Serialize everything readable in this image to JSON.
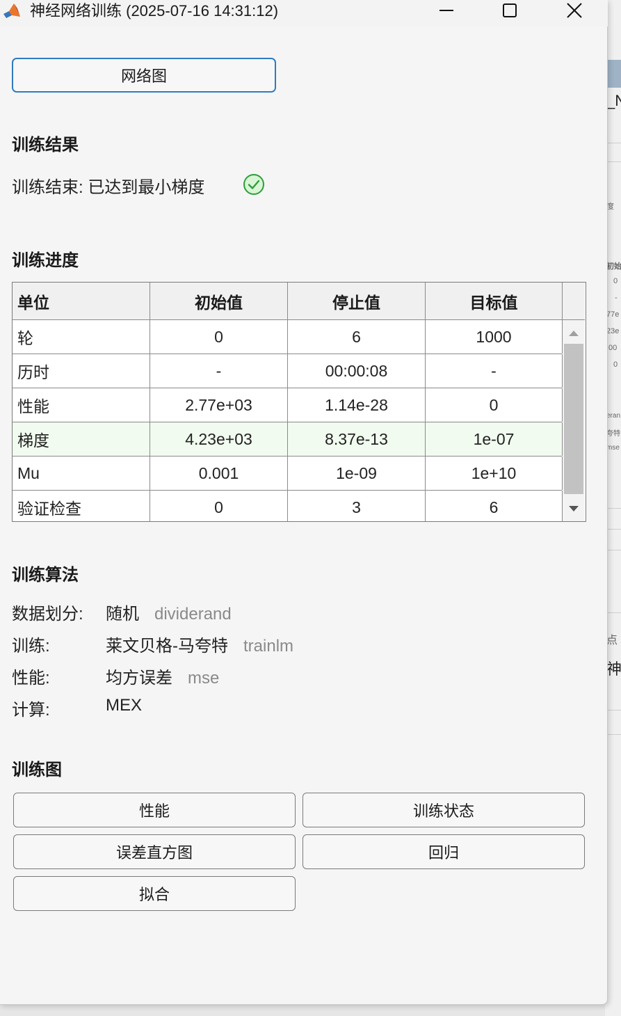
{
  "window": {
    "title": "神经网络训练 (2025-07-16 14:31:12)",
    "controls": [
      "minimize",
      "maximize",
      "close"
    ]
  },
  "network": {
    "button_label": "网络图"
  },
  "results": {
    "heading": "训练结果",
    "status_text": "训练结束: 已达到最小梯度",
    "status_icon": "check-circle-icon",
    "status_color": "#2e9e3a"
  },
  "progress": {
    "heading": "训练进度",
    "columns": [
      "单位",
      "初始值",
      "停止值",
      "目标值"
    ],
    "rows": [
      [
        "轮",
        "0",
        "6",
        "1000"
      ],
      [
        "历时",
        "-",
        "00:00:08",
        "-"
      ],
      [
        "性能",
        "2.77e+03",
        "1.14e-28",
        "0"
      ],
      [
        "梯度",
        "4.23e+03",
        "8.37e-13",
        "1e-07"
      ],
      [
        "Mu",
        "0.001",
        "1e-09",
        "1e+10"
      ],
      [
        "验证检查",
        "0",
        "3",
        "6"
      ]
    ],
    "highlighted_row": 3,
    "highlight_color": "#f1fbef"
  },
  "algorithms": {
    "heading": "训练算法",
    "items": [
      {
        "label": "数据划分:",
        "name": "随机",
        "fn": "dividerand"
      },
      {
        "label": "训练:",
        "name": "莱文贝格-马夸特",
        "fn": "trainlm"
      },
      {
        "label": "性能:",
        "name": "均方误差",
        "fn": "mse"
      },
      {
        "label": "计算:",
        "name": "MEX",
        "fn": ""
      }
    ]
  },
  "plots": {
    "heading": "训练图",
    "buttons": [
      "性能",
      "训练状态",
      "误差直方图",
      "回归",
      "拟合"
    ]
  },
  "background_window": {
    "fragments": [
      "_N",
      "度",
      "初始值",
      "0",
      "-",
      "77e",
      "23e",
      ".00",
      "0",
      "eran",
      "夸特",
      "mse",
      "点 原",
      "神经"
    ]
  }
}
